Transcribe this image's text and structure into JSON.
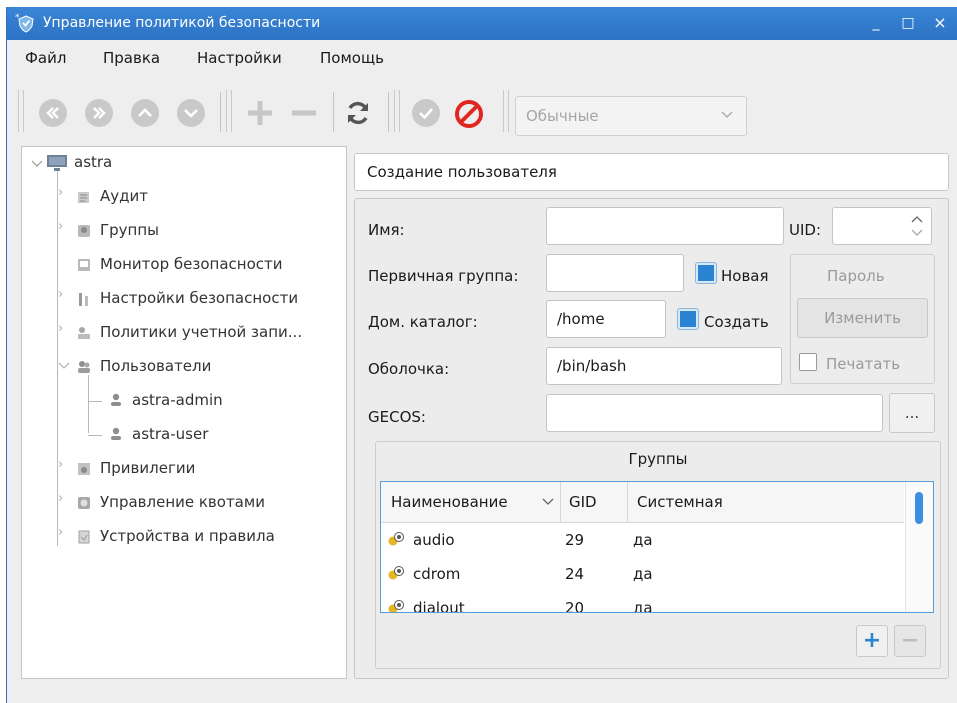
{
  "window": {
    "title": "Управление политикой безопасности",
    "controls": [
      "_",
      "□",
      "×"
    ]
  },
  "menu": [
    "Файл",
    "Правка",
    "Настройки",
    "Помощь"
  ],
  "toolbar": {
    "icons": [
      "first-icon",
      "last-icon",
      "up-icon",
      "down-icon",
      "add-icon",
      "remove-icon",
      "refresh-icon",
      "apply-icon",
      "cancel-icon"
    ],
    "filter": {
      "selected": "Обычные"
    }
  },
  "tree": {
    "root": "astra",
    "items": [
      "Аудит",
      "Группы",
      "Монитор безопасности",
      "Настройки безопасности",
      "Политики учетной запи...",
      "Пользователи",
      "astra-admin",
      "astra-user",
      "Привилегии",
      "Управление квотами",
      "Устройства и правила"
    ]
  },
  "panel": {
    "title": "Создание пользователя",
    "labels": {
      "name": "Имя:",
      "uid": "UID:",
      "primary_group": "Первичная группа:",
      "home": "Дом. каталог:",
      "shell": "Оболочка:",
      "gecos": "GECOS:"
    },
    "values": {
      "name": "",
      "uid": "",
      "primary_group": "",
      "home": "/home",
      "shell": "/bin/bash",
      "gecos": ""
    },
    "checks": {
      "new": "Новая",
      "new_checked": true,
      "create": "Создать",
      "create_checked": true,
      "print": "Печатать",
      "print_checked": false
    },
    "buttons": {
      "password": "Пароль",
      "change": "Изменить",
      "browse": "..."
    }
  },
  "groups": {
    "title": "Группы",
    "columns": [
      "Наименование",
      "GID",
      "Системная"
    ],
    "rows": [
      {
        "name": "audio",
        "gid": "29",
        "system": "да"
      },
      {
        "name": "cdrom",
        "gid": "24",
        "system": "да"
      },
      {
        "name": "dialout",
        "gid": "20",
        "system": "да"
      }
    ],
    "add": "+",
    "remove": "−"
  },
  "colors": {
    "titlebar": "#2d72c4",
    "accent": "#2a84d2",
    "cancel": "#e0271f"
  }
}
